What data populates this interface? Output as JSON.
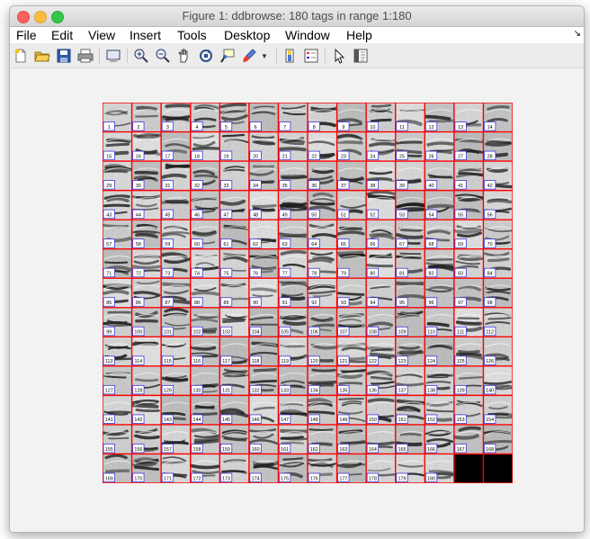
{
  "window": {
    "title": "Figure 1: ddbrowse: 180 tags in range 1:180"
  },
  "menubar": {
    "items": [
      "File",
      "Edit",
      "View",
      "Insert",
      "Tools",
      "Desktop",
      "Window",
      "Help"
    ]
  },
  "toolbar": {
    "icons": [
      "new-figure-icon",
      "open-file-icon",
      "save-icon",
      "print-icon",
      "print-preview-icon",
      "zoom-in-icon",
      "zoom-out-icon",
      "pan-icon",
      "rotate-3d-icon",
      "data-cursor-icon",
      "brush-icon",
      "colorbar-icon",
      "legend-icon",
      "edit-plot-icon",
      "property-inspector-icon"
    ]
  },
  "montage": {
    "tag_count": 180,
    "columns": 14,
    "rows": 13,
    "colors": {
      "grid_line": "#ff0000",
      "label_border": "#3c3cd8",
      "empty_tile": "#000000"
    }
  }
}
